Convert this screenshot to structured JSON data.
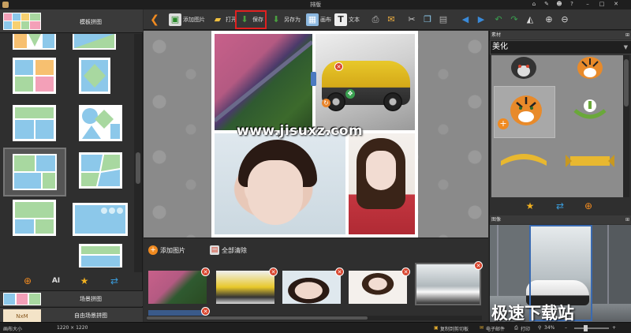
{
  "window": {
    "title": "排版"
  },
  "left_panel": {
    "template_header": "模板拼图",
    "scene_label": "场景拼图",
    "freeform_label": "自由场景拼图",
    "freeform_thumb_text": "NxM"
  },
  "toolbar": {
    "add_image": "添加图片",
    "open": "打开",
    "save": "保存",
    "save_as": "另存为",
    "canvas": "画布",
    "text": "文本"
  },
  "canvas": {
    "watermark": "www.jisuxz.com"
  },
  "image_bar": {
    "add_image": "添加图片",
    "clear_all": "全部清除"
  },
  "right_panel": {
    "stickers_title": "素材",
    "category": "美化",
    "image_title": "图像",
    "brand_watermark": "极速下载站"
  },
  "status": {
    "canvas_size_label": "画布大小",
    "canvas_size_value": "1220 × 1220",
    "copy_clipboard": "复制到剪切板",
    "email": "电子邮件",
    "print": "打印",
    "zoom": "34%"
  },
  "colors": {
    "accent_red": "#e02020",
    "delete_red": "#d8452e",
    "bg": "#2b2b2b"
  },
  "icons": [
    "back-arrow-icon",
    "add-image-icon",
    "open-folder-icon",
    "save-icon",
    "save-as-icon",
    "canvas-icon",
    "text-icon",
    "print-icon",
    "email-icon",
    "cut-icon",
    "copy-icon",
    "paste-icon",
    "align-left-icon",
    "align-right-icon",
    "rotate-left-icon",
    "rotate-right-icon",
    "flip-icon",
    "zoom-in-icon",
    "zoom-out-icon"
  ]
}
